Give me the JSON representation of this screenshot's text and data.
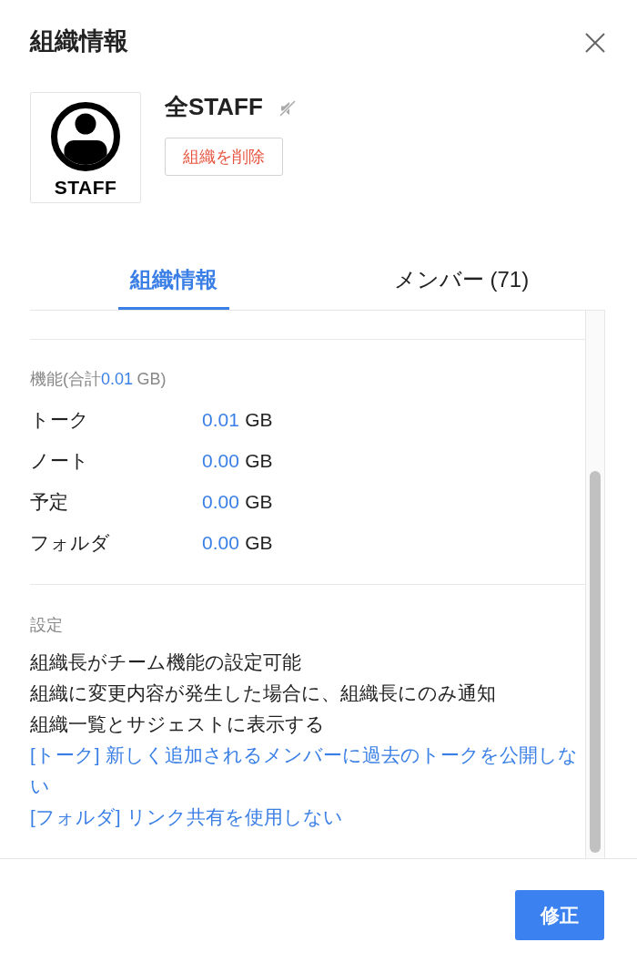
{
  "dialog": {
    "title": "組織情報"
  },
  "group": {
    "logo_text": "STAFF",
    "name": "全STAFF",
    "muted": true,
    "delete_button": "組織を削除"
  },
  "tabs": [
    {
      "label": "組織情報",
      "selected": true
    },
    {
      "label": "メンバー (71)",
      "selected": false
    }
  ],
  "storage": {
    "heading_prefix": "機能(合計",
    "total": "0.01",
    "heading_suffix": "GB)",
    "rows": [
      {
        "label": "トーク",
        "value": "0.01",
        "unit": "GB"
      },
      {
        "label": "ノート",
        "value": "0.00",
        "unit": "GB"
      },
      {
        "label": "予定",
        "value": "0.00",
        "unit": "GB"
      },
      {
        "label": "フォルダ",
        "value": "0.00",
        "unit": "GB"
      }
    ]
  },
  "settings": {
    "heading": "設定",
    "items": [
      {
        "text": "組織長がチーム機能の設定可能",
        "highlighted": false
      },
      {
        "text": "組織に変更内容が発生した場合に、組織長にのみ通知",
        "highlighted": false
      },
      {
        "text": "組織一覧とサジェストに表示する",
        "highlighted": false
      },
      {
        "text": "[トーク] 新しく追加されるメンバーに過去のトークを公開しない",
        "highlighted": true
      },
      {
        "text": "[フォルダ] リンク共有を使用しない",
        "highlighted": true
      }
    ]
  },
  "footer": {
    "edit_button": "修正"
  }
}
